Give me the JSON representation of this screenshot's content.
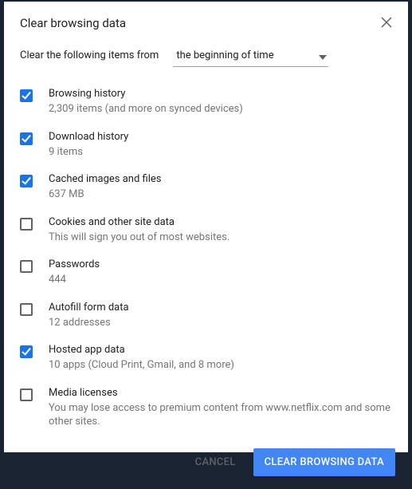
{
  "dialog": {
    "title": "Clear browsing data",
    "timeRowLabel": "Clear the following items from",
    "timeRangeSelected": "the beginning of time"
  },
  "items": [
    {
      "label": "Browsing history",
      "desc": "2,309 items (and more on synced devices)",
      "checked": true
    },
    {
      "label": "Download history",
      "desc": "9 items",
      "checked": true
    },
    {
      "label": "Cached images and files",
      "desc": "637 MB",
      "checked": true
    },
    {
      "label": "Cookies and other site data",
      "desc": "This will sign you out of most websites.",
      "checked": false
    },
    {
      "label": "Passwords",
      "desc": "444",
      "checked": false
    },
    {
      "label": "Autofill form data",
      "desc": "12 addresses",
      "checked": false
    },
    {
      "label": "Hosted app data",
      "desc": "10 apps (Cloud Print, Gmail, and 8 more)",
      "checked": true
    },
    {
      "label": "Media licenses",
      "desc": "You may lose access to premium content from www.netflix.com and some other sites.",
      "checked": false
    }
  ],
  "buttons": {
    "cancel": "Cancel",
    "confirm": "Clear browsing data"
  }
}
